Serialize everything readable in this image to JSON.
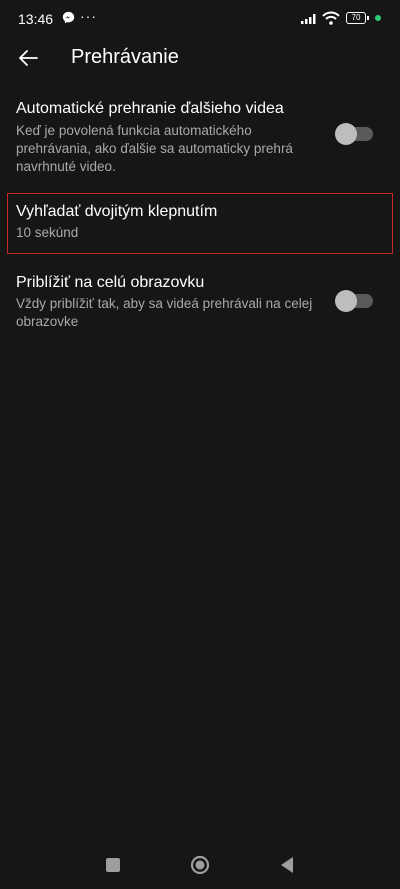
{
  "status_bar": {
    "time": "13:46",
    "dots": "···",
    "battery": "70"
  },
  "header": {
    "title": "Prehrávanie"
  },
  "settings": {
    "autoplay": {
      "title": "Automatické prehranie ďalšieho videa",
      "subtitle": "Keď je povolená funkcia automatického prehrávania, ako ďalšie sa automaticky prehrá navrhnuté video.",
      "enabled": false
    },
    "double_tap": {
      "title": "Vyhľadať dvojitým klepnutím",
      "value": "10 sekúnd"
    },
    "zoom": {
      "title": "Priblížiť na celú obrazovku",
      "subtitle": "Vždy priblížiť tak, aby sa videá prehrávali na celej obrazovke",
      "enabled": false
    }
  },
  "colors": {
    "background": "#161616",
    "highlight_border": "#c62828",
    "status_dot": "#2ecc71"
  },
  "icons": [
    "messenger-icon",
    "signal-icon",
    "wifi-icon",
    "battery-icon",
    "back-arrow-icon",
    "recents-icon",
    "home-icon",
    "back-nav-icon"
  ]
}
